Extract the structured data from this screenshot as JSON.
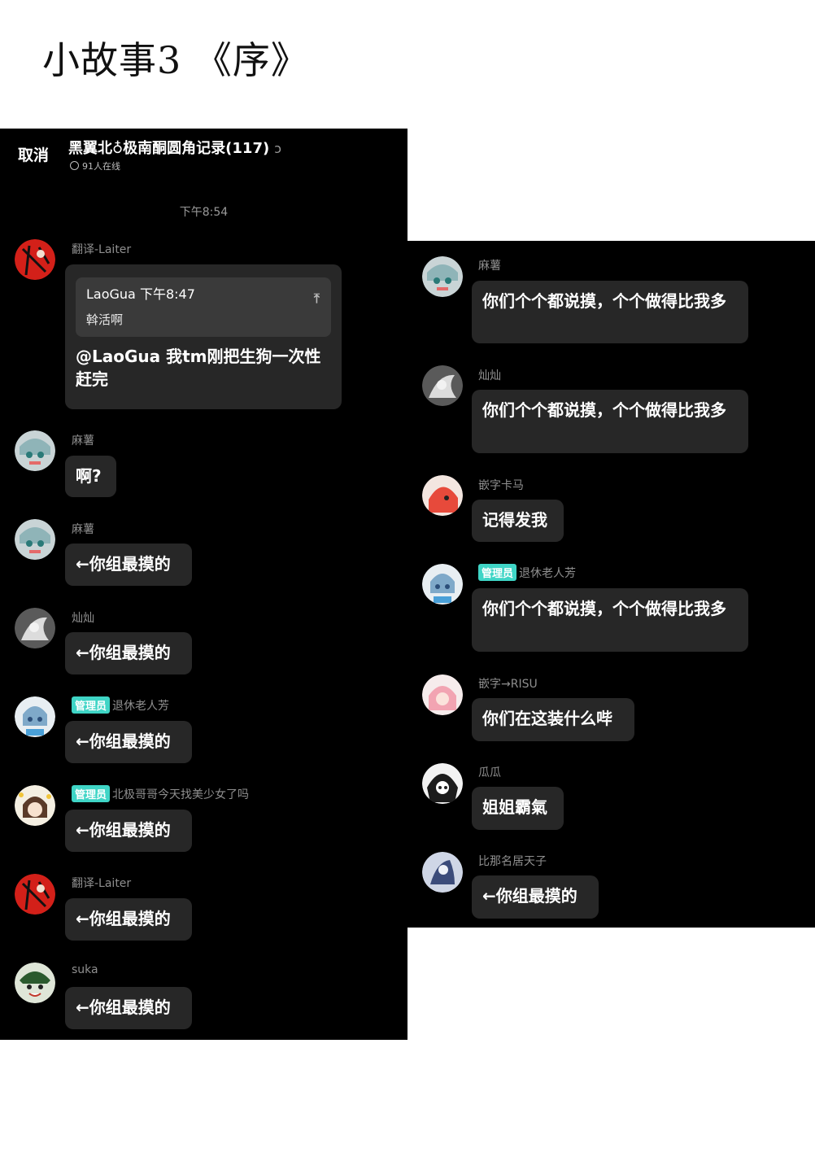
{
  "page_title": "小故事3 《序》",
  "header": {
    "cancel_label": "取消",
    "group_title": "黑翼北♁极南酮圆角记录(117)",
    "ear_icon": "ear-icon",
    "online_text": "91人在线"
  },
  "time_divider": "下午8:54",
  "badge_admin": "管理员",
  "left_messages": [
    {
      "sender": "翻译-Laiter",
      "quote_head": "LaoGua 下午8:47",
      "quote_body": "斡活啊",
      "text": "@LaoGua 我tm刚把生狗一次性赶完"
    },
    {
      "sender": "麻薯",
      "text": "啊?"
    },
    {
      "sender": "麻薯",
      "text": "←你组最摸的"
    },
    {
      "sender": "灿灿",
      "text": "←你组最摸的"
    },
    {
      "sender": "退休老人芳",
      "text": "←你组最摸的"
    },
    {
      "sender": "北极哥哥今天找美少女了吗",
      "text": "←你组最摸的"
    },
    {
      "sender": "翻译-Laiter",
      "text": "←你组最摸的"
    },
    {
      "sender": "suka",
      "text": "←你组最摸的"
    }
  ],
  "right_messages": [
    {
      "sender": "麻薯",
      "text": "你们个个都说摸，个个做得比我多"
    },
    {
      "sender": "灿灿",
      "text": "你们个个都说摸，个个做得比我多"
    },
    {
      "sender": "嵌字卡马",
      "text": "记得发我"
    },
    {
      "sender": "退休老人芳",
      "text": "你们个个都说摸，个个做得比我多"
    },
    {
      "sender": "嵌字→RISU",
      "text": "你们在这装什么哔"
    },
    {
      "sender": "瓜瓜",
      "text": "姐姐霸氣"
    },
    {
      "sender": "比那名居天子",
      "text": "←你组最摸的"
    }
  ]
}
